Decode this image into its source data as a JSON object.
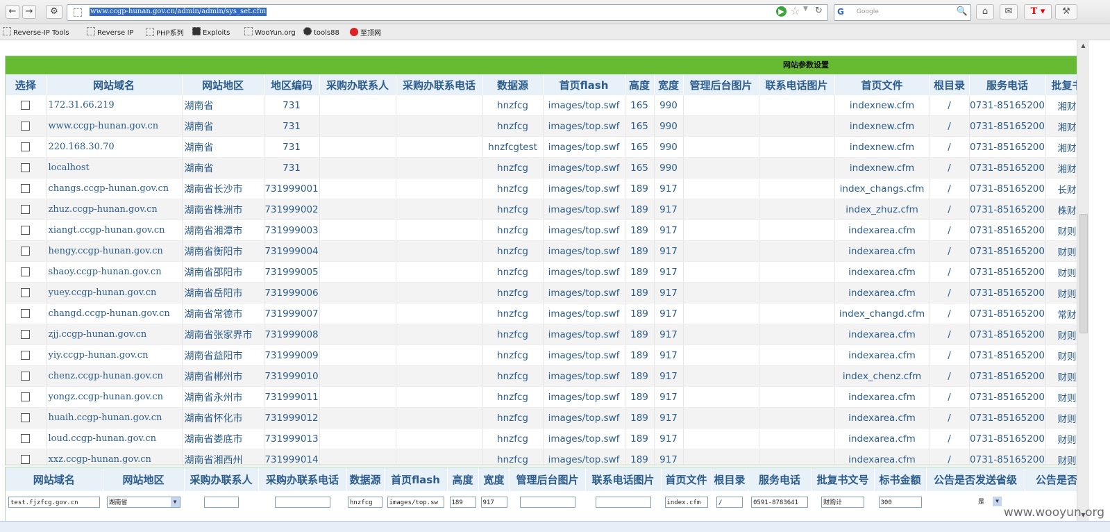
{
  "browser": {
    "url": "www.ccgp-hunan.gov.cn/admin/admin/sys_set.cfm",
    "search_placeholder": "Google",
    "bookmarks": [
      "Reverse-IP Tools",
      "Reverse IP",
      "PHP系列",
      "Exploits",
      "WooYun.org",
      "tools88",
      "至顶网"
    ]
  },
  "page": {
    "title": "网站参数设置",
    "headers": [
      "选择",
      "网站域名",
      "网站地区",
      "地区编码",
      "采购办联系人",
      "采购办联系电话",
      "数据源",
      "首页flash",
      "高度",
      "宽度",
      "管理后台图片",
      "联系电话图片",
      "首页文件",
      "根目录",
      "服务电话",
      "批复书"
    ],
    "rows": [
      {
        "domain": "172.31.66.219",
        "region": "湖南省",
        "code": "731",
        "contact": "",
        "phone": "",
        "ds": "hnzfcg",
        "flash": "images/top.swf",
        "h": "165",
        "w": "990",
        "adminimg": "",
        "telimg": "",
        "file": "indexnew.cfm",
        "root": "/",
        "service": "0731-85165200",
        "reply": "湘财"
      },
      {
        "domain": "www.ccgp-hunan.gov.cn",
        "region": "湖南省",
        "code": "731",
        "contact": "",
        "phone": "",
        "ds": "hnzfcg",
        "flash": "images/top.swf",
        "h": "165",
        "w": "990",
        "adminimg": "",
        "telimg": "",
        "file": "indexnew.cfm",
        "root": "/",
        "service": "0731-85165200",
        "reply": "湘财"
      },
      {
        "domain": "220.168.30.70",
        "region": "湖南省",
        "code": "731",
        "contact": "",
        "phone": "",
        "ds": "hnzfcgtest",
        "flash": "images/top.swf",
        "h": "165",
        "w": "990",
        "adminimg": "",
        "telimg": "",
        "file": "indexnew.cfm",
        "root": "/",
        "service": "0731-85165200",
        "reply": "湘财"
      },
      {
        "domain": "localhost",
        "region": "湖南省",
        "code": "731",
        "contact": "",
        "phone": "",
        "ds": "hnzfcg",
        "flash": "images/top.swf",
        "h": "165",
        "w": "990",
        "adminimg": "",
        "telimg": "",
        "file": "indexnew.cfm",
        "root": "/",
        "service": "0731-85165200",
        "reply": "湘财"
      },
      {
        "domain": "changs.ccgp-hunan.gov.cn",
        "region": "湖南省长沙市",
        "code": "731999001",
        "contact": "",
        "phone": "",
        "ds": "hnzfcg",
        "flash": "images/top.swf",
        "h": "189",
        "w": "917",
        "adminimg": "",
        "telimg": "",
        "file": "index_changs.cfm",
        "root": "/",
        "service": "0731-85165200",
        "reply": "长财"
      },
      {
        "domain": "zhuz.ccgp-hunan.gov.cn",
        "region": "湖南省株洲市",
        "code": "731999002",
        "contact": "",
        "phone": "",
        "ds": "hnzfcg",
        "flash": "images/top.swf",
        "h": "189",
        "w": "917",
        "adminimg": "",
        "telimg": "",
        "file": "index_zhuz.cfm",
        "root": "/",
        "service": "0731-85165200",
        "reply": "株财"
      },
      {
        "domain": "xiangt.ccgp-hunan.gov.cn",
        "region": "湖南省湘潭市",
        "code": "731999003",
        "contact": "",
        "phone": "",
        "ds": "hnzfcg",
        "flash": "images/top.swf",
        "h": "189",
        "w": "917",
        "adminimg": "",
        "telimg": "",
        "file": "indexarea.cfm",
        "root": "/",
        "service": "0731-85165200",
        "reply": "财则"
      },
      {
        "domain": "hengy.ccgp-hunan.gov.cn",
        "region": "湖南省衡阳市",
        "code": "731999004",
        "contact": "",
        "phone": "",
        "ds": "hnzfcg",
        "flash": "images/top.swf",
        "h": "189",
        "w": "917",
        "adminimg": "",
        "telimg": "",
        "file": "indexarea.cfm",
        "root": "/",
        "service": "0731-85165200",
        "reply": "财则"
      },
      {
        "domain": "shaoy.ccgp-hunan.gov.cn",
        "region": "湖南省邵阳市",
        "code": "731999005",
        "contact": "",
        "phone": "",
        "ds": "hnzfcg",
        "flash": "images/top.swf",
        "h": "189",
        "w": "917",
        "adminimg": "",
        "telimg": "",
        "file": "indexarea.cfm",
        "root": "/",
        "service": "0731-85165200",
        "reply": "财则"
      },
      {
        "domain": "yuey.ccgp-hunan.gov.cn",
        "region": "湖南省岳阳市",
        "code": "731999006",
        "contact": "",
        "phone": "",
        "ds": "hnzfcg",
        "flash": "images/top.swf",
        "h": "189",
        "w": "917",
        "adminimg": "",
        "telimg": "",
        "file": "indexarea.cfm",
        "root": "/",
        "service": "0731-85165200",
        "reply": "财则"
      },
      {
        "domain": "changd.ccgp-hunan.gov.cn",
        "region": "湖南省常德市",
        "code": "731999007",
        "contact": "",
        "phone": "",
        "ds": "hnzfcg",
        "flash": "images/top.swf",
        "h": "189",
        "w": "917",
        "adminimg": "",
        "telimg": "",
        "file": "index_changd.cfm",
        "root": "/",
        "service": "0731-85165200",
        "reply": "常财"
      },
      {
        "domain": "zjj.ccgp-hunan.gov.cn",
        "region": "湖南省张家界市",
        "code": "731999008",
        "contact": "",
        "phone": "",
        "ds": "hnzfcg",
        "flash": "images/top.swf",
        "h": "189",
        "w": "917",
        "adminimg": "",
        "telimg": "",
        "file": "indexarea.cfm",
        "root": "/",
        "service": "0731-85165200",
        "reply": "财则"
      },
      {
        "domain": "yiy.ccgp-hunan.gov.cn",
        "region": "湖南省益阳市",
        "code": "731999009",
        "contact": "",
        "phone": "",
        "ds": "hnzfcg",
        "flash": "images/top.swf",
        "h": "189",
        "w": "917",
        "adminimg": "",
        "telimg": "",
        "file": "indexarea.cfm",
        "root": "/",
        "service": "0731-85165200",
        "reply": "财则"
      },
      {
        "domain": "chenz.ccgp-hunan.gov.cn",
        "region": "湖南省郴州市",
        "code": "731999010",
        "contact": "",
        "phone": "",
        "ds": "hnzfcg",
        "flash": "images/top.swf",
        "h": "189",
        "w": "917",
        "adminimg": "",
        "telimg": "",
        "file": "index_chenz.cfm",
        "root": "/",
        "service": "0731-85165200",
        "reply": "财则"
      },
      {
        "domain": "yongz.ccgp-hunan.gov.cn",
        "region": "湖南省永州市",
        "code": "731999011",
        "contact": "",
        "phone": "",
        "ds": "hnzfcg",
        "flash": "images/top.swf",
        "h": "189",
        "w": "917",
        "adminimg": "",
        "telimg": "",
        "file": "indexarea.cfm",
        "root": "/",
        "service": "0731-85165200",
        "reply": "财则"
      },
      {
        "domain": "huaih.ccgp-hunan.gov.cn",
        "region": "湖南省怀化市",
        "code": "731999012",
        "contact": "",
        "phone": "",
        "ds": "hnzfcg",
        "flash": "images/top.swf",
        "h": "189",
        "w": "917",
        "adminimg": "",
        "telimg": "",
        "file": "indexarea.cfm",
        "root": "/",
        "service": "0731-85165200",
        "reply": "财则"
      },
      {
        "domain": "loud.ccgp-hunan.gov.cn",
        "region": "湖南省娄底市",
        "code": "731999013",
        "contact": "",
        "phone": "",
        "ds": "hnzfcg",
        "flash": "images/top.swf",
        "h": "189",
        "w": "917",
        "adminimg": "",
        "telimg": "",
        "file": "indexarea.cfm",
        "root": "/",
        "service": "0731-85165200",
        "reply": "财则"
      },
      {
        "domain": "xxz.ccgp-hunan.gov.cn",
        "region": "湖南省湘西州",
        "code": "731999014",
        "contact": "",
        "phone": "",
        "ds": "hnzfcg",
        "flash": "images/top.swf",
        "h": "189",
        "w": "917",
        "adminimg": "",
        "telimg": "",
        "file": "indexarea.cfm",
        "root": "/",
        "service": "0731-85165200",
        "reply": "财则"
      }
    ]
  },
  "form": {
    "headers": [
      "网站域名",
      "网站地区",
      "采购办联系人",
      "采购办联系电话",
      "数据源",
      "首页flash",
      "高度",
      "宽度",
      "管理后台图片",
      "联系电话图片",
      "首页文件",
      "根目录",
      "服务电话",
      "批复书文号",
      "标书金额",
      "公告是否发送省级",
      "公告是否"
    ],
    "values": {
      "domain": "test.fjzfcg.gov.cn",
      "region": "湖南省",
      "contact": "",
      "phone": "",
      "ds": "hnzfcg",
      "flash": "images/top.sw",
      "h": "189",
      "w": "917",
      "adminimg": "",
      "telimg": "",
      "file": "index.cfm",
      "root": "/",
      "service": "0591-8783641",
      "reply": "财购计",
      "amount": "300",
      "send": "是"
    }
  },
  "watermark": "www.wooyun.org"
}
